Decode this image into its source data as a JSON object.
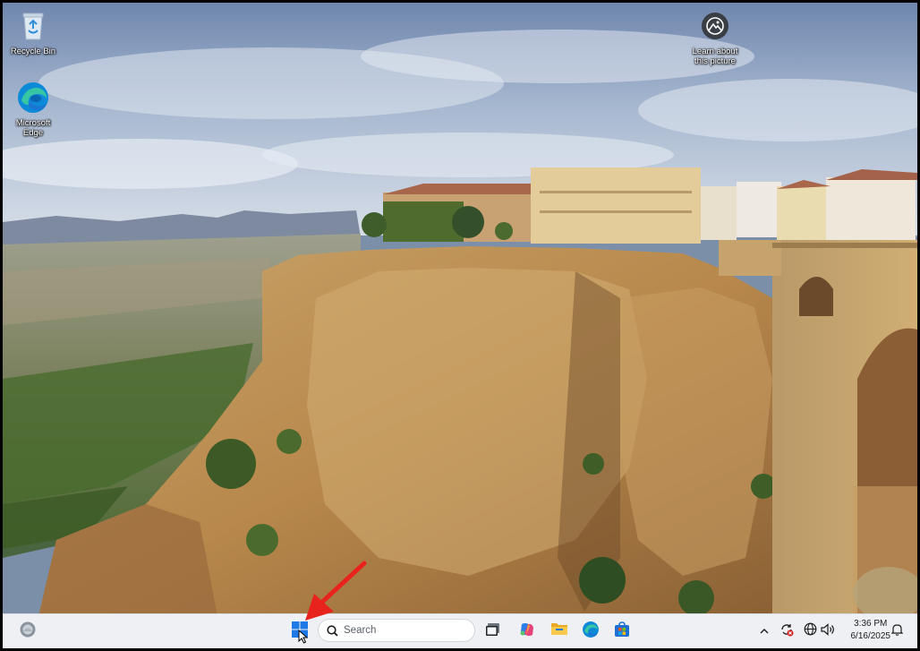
{
  "desktop": {
    "icons": [
      {
        "label": "Recycle Bin",
        "icon": "recycle-bin-icon"
      },
      {
        "label": "Microsoft Edge",
        "icon": "edge-icon"
      },
      {
        "label": "Learn about this picture",
        "icon": "learn-picture-icon"
      }
    ]
  },
  "taskbar": {
    "widgets_icon": "widgets-icon",
    "start_icon": "windows-start-icon",
    "search": {
      "placeholder": "Search",
      "icon": "search-icon"
    },
    "apps": [
      {
        "name": "task-view",
        "icon": "task-view-icon"
      },
      {
        "name": "copilot",
        "icon": "copilot-icon"
      },
      {
        "name": "file-explorer",
        "icon": "file-explorer-icon"
      },
      {
        "name": "microsoft-edge",
        "icon": "edge-icon"
      },
      {
        "name": "microsoft-store",
        "icon": "store-icon"
      }
    ],
    "tray": {
      "icons": [
        "chevron-up-icon",
        "sync-alert-icon",
        "globe-icon",
        "volume-icon",
        "notification-bell-icon"
      ],
      "time": "3:36 PM",
      "date": "6/16/2025"
    }
  },
  "annotation": {
    "type": "red-arrow",
    "target": "windows-start-icon",
    "color": "#e8231d"
  },
  "colors": {
    "taskbar_bg": "#eef0f4",
    "arrow_red": "#e8231d",
    "start_blue": "#1f7ae6"
  }
}
